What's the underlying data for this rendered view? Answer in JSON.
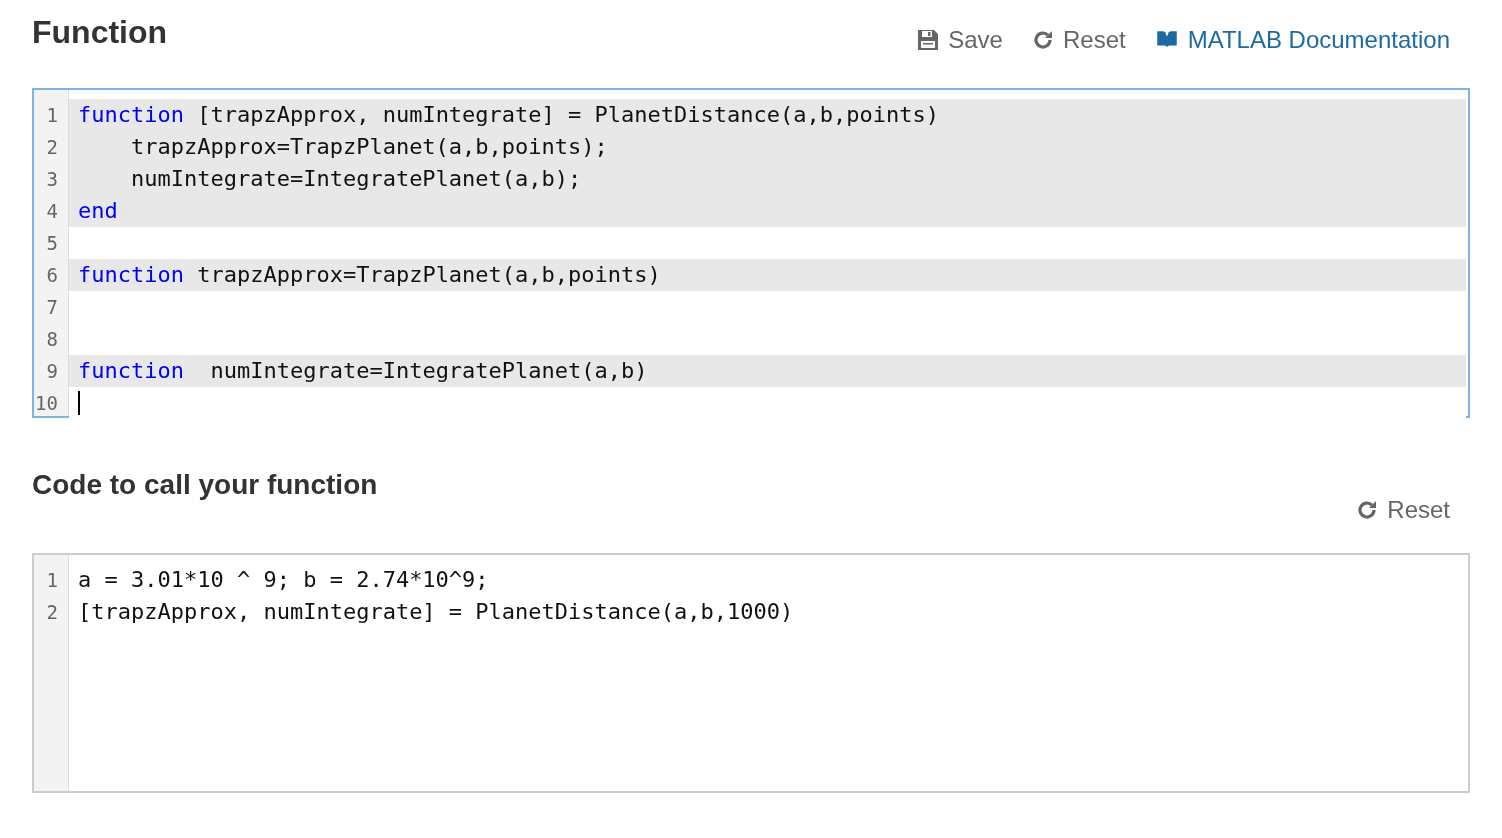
{
  "function_section": {
    "title": "Function",
    "toolbar": [
      {
        "kind": "save",
        "label": "Save"
      },
      {
        "kind": "reset",
        "label": "Reset"
      },
      {
        "kind": "docs",
        "label": "MATLAB Documentation"
      }
    ],
    "editor": {
      "lines": [
        {
          "number": "1",
          "highlighted": true,
          "cursor": false,
          "segments": [
            {
              "kind": "keyword",
              "text": "function"
            },
            {
              "kind": "plain",
              "text": " [trapzApprox, numIntegrate] = PlanetDistance(a,b,points)"
            }
          ]
        },
        {
          "number": "2",
          "highlighted": true,
          "cursor": false,
          "segments": [
            {
              "kind": "plain",
              "text": "    trapzApprox=TrapzPlanet(a,b,points);"
            }
          ]
        },
        {
          "number": "3",
          "highlighted": true,
          "cursor": false,
          "segments": [
            {
              "kind": "plain",
              "text": "    numIntegrate=IntegratePlanet(a,b);"
            }
          ]
        },
        {
          "number": "4",
          "highlighted": true,
          "cursor": false,
          "segments": [
            {
              "kind": "keyword",
              "text": "end"
            }
          ]
        },
        {
          "number": "5",
          "highlighted": false,
          "cursor": false
        },
        {
          "number": "6",
          "highlighted": true,
          "cursor": false,
          "segments": [
            {
              "kind": "keyword",
              "text": "function"
            },
            {
              "kind": "plain",
              "text": " trapzApprox=TrapzPlanet(a,b,points)"
            }
          ]
        },
        {
          "number": "7",
          "highlighted": false,
          "cursor": false
        },
        {
          "number": "8",
          "highlighted": false,
          "cursor": false
        },
        {
          "number": "9",
          "highlighted": true,
          "cursor": false,
          "segments": [
            {
              "kind": "keyword",
              "text": "function"
            },
            {
              "kind": "plain",
              "text": "  numIntegrate=IntegratePlanet(a,b)"
            }
          ]
        },
        {
          "number": "10",
          "highlighted": false,
          "cursor": true
        }
      ],
      "focused": true
    }
  },
  "call_section": {
    "title": "Code to call your function",
    "toolbar": [
      {
        "kind": "reset",
        "label": "Reset"
      }
    ],
    "editor": {
      "lines": [
        {
          "number": "1",
          "highlighted": false,
          "cursor": false,
          "segments": [
            {
              "kind": "plain",
              "text": "a = 3.01*10 ^ 9; b = 2.74*10^9;"
            }
          ]
        },
        {
          "number": "2",
          "highlighted": false,
          "cursor": false,
          "segments": [
            {
              "kind": "plain",
              "text": "[trapzApprox, numIntegrate] = PlanetDistance(a,b,1000)"
            }
          ]
        }
      ],
      "focused": false
    }
  }
}
